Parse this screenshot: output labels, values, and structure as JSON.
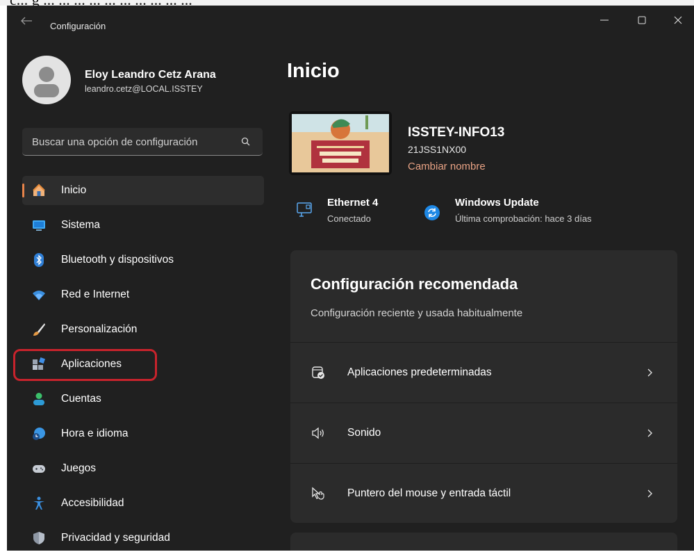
{
  "top_strip_text": "c... g ... ... ... ... ... ... ... ... ... ...",
  "window": {
    "title": "Configuración"
  },
  "user": {
    "name": "Eloy Leandro Cetz Arana",
    "email": "leandro.cetz@LOCAL.ISSTEY"
  },
  "search": {
    "placeholder": "Buscar una opción de configuración"
  },
  "nav": [
    {
      "label": "Inicio",
      "icon": "home-icon"
    },
    {
      "label": "Sistema",
      "icon": "monitor-icon"
    },
    {
      "label": "Bluetooth y dispositivos",
      "icon": "bluetooth-icon"
    },
    {
      "label": "Red e Internet",
      "icon": "wifi-icon"
    },
    {
      "label": "Personalización",
      "icon": "brush-icon"
    },
    {
      "label": "Aplicaciones",
      "icon": "apps-icon"
    },
    {
      "label": "Cuentas",
      "icon": "person-icon"
    },
    {
      "label": "Hora e idioma",
      "icon": "globe-clock-icon"
    },
    {
      "label": "Juegos",
      "icon": "gamepad-icon"
    },
    {
      "label": "Accesibilidad",
      "icon": "accessibility-icon"
    },
    {
      "label": "Privacidad y seguridad",
      "icon": "shield-icon"
    }
  ],
  "main": {
    "title": "Inicio",
    "device": {
      "name": "ISSTEY-INFO13",
      "model": "21JSS1NX00",
      "rename": "Cambiar nombre"
    },
    "status": [
      {
        "title": "Ethernet 4",
        "subtitle": "Conectado",
        "icon": "ethernet-icon"
      },
      {
        "title": "Windows Update",
        "subtitle": "Última comprobación: hace 3 días",
        "icon": "update-icon"
      }
    ],
    "card": {
      "title": "Configuración recomendada",
      "subtitle": "Configuración reciente y usada habitualmente",
      "rows": [
        {
          "label": "Aplicaciones predeterminadas",
          "icon": "default-apps-icon"
        },
        {
          "label": "Sonido",
          "icon": "speaker-icon"
        },
        {
          "label": "Puntero del mouse y entrada táctil",
          "icon": "pointer-icon"
        }
      ]
    }
  },
  "colors": {
    "accent": "#e8844a",
    "highlight": "#c8232c",
    "background": "#202020",
    "card": "#2b2b2b"
  }
}
